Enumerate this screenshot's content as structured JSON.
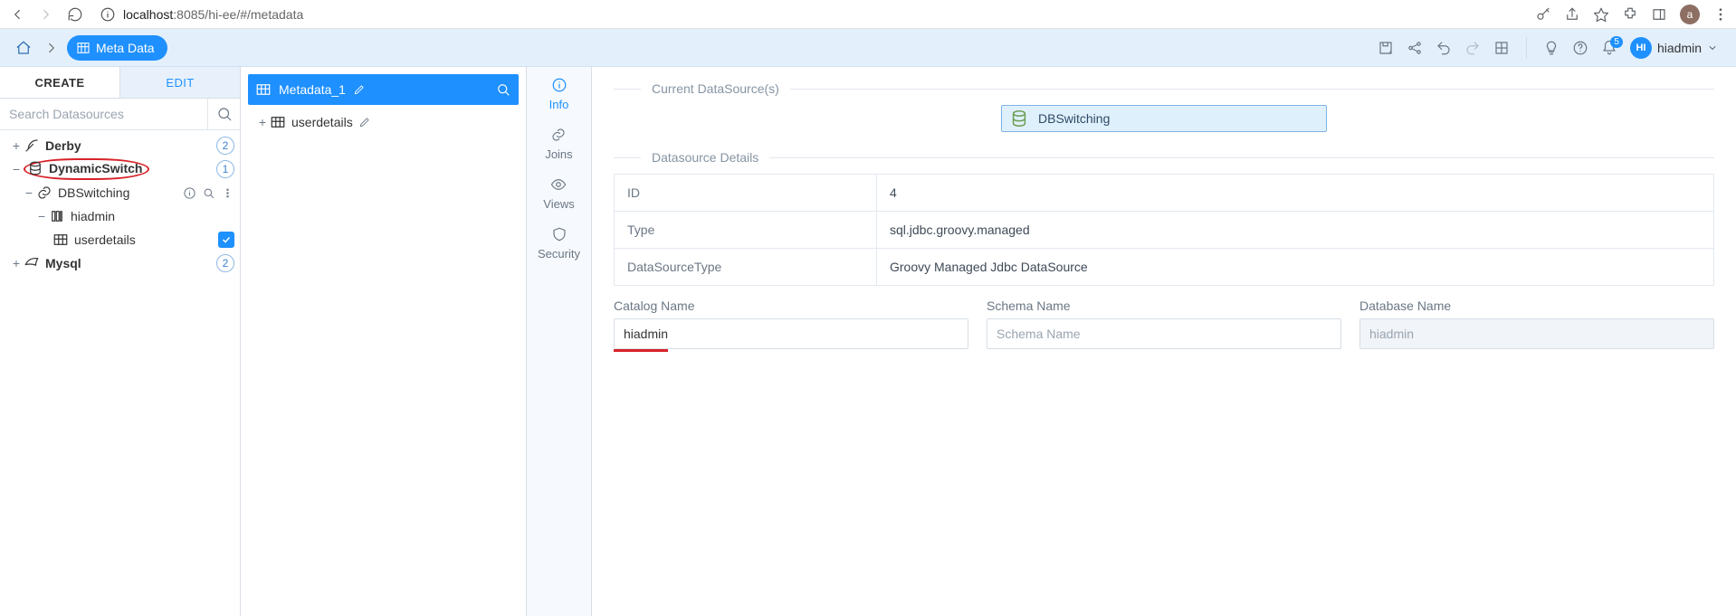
{
  "chrome": {
    "url_host": "localhost",
    "url_rest": ":8085/hi-ee/#/metadata",
    "avatar": "a"
  },
  "breadcrumb": {
    "label": "Meta Data"
  },
  "header": {
    "notif_count": "5",
    "user_initials": "HI",
    "user_name": "hiadmin"
  },
  "left": {
    "tab_create": "CREATE",
    "tab_edit": "EDIT",
    "search_placeholder": "Search Datasources",
    "nodes": {
      "derby": {
        "label": "Derby",
        "badge": "2"
      },
      "dynswitch": {
        "label": "DynamicSwitch",
        "badge": "1"
      },
      "dbswitching": {
        "label": "DBSwitching"
      },
      "hiadmin": {
        "label": "hiadmin"
      },
      "userdetails": {
        "label": "userdetails"
      },
      "mysql": {
        "label": "Mysql",
        "badge": "2"
      }
    }
  },
  "mid": {
    "header_label": "Metadata_1",
    "item_userdetails": "userdetails"
  },
  "nav": {
    "info": "Info",
    "joins": "Joins",
    "views": "Views",
    "security": "Security"
  },
  "content": {
    "section_current": "Current DataSource(s)",
    "current_ds": "DBSwitching",
    "section_details": "Datasource Details",
    "details": {
      "id_label": "ID",
      "id_value": "4",
      "type_label": "Type",
      "type_value": "sql.jdbc.groovy.managed",
      "dstype_label": "DataSourceType",
      "dstype_value": "Groovy Managed Jdbc DataSource"
    },
    "catalog_label": "Catalog Name",
    "catalog_value": "hiadmin",
    "schema_label": "Schema Name",
    "schema_placeholder": "Schema Name",
    "database_label": "Database Name",
    "database_value": "hiadmin"
  }
}
